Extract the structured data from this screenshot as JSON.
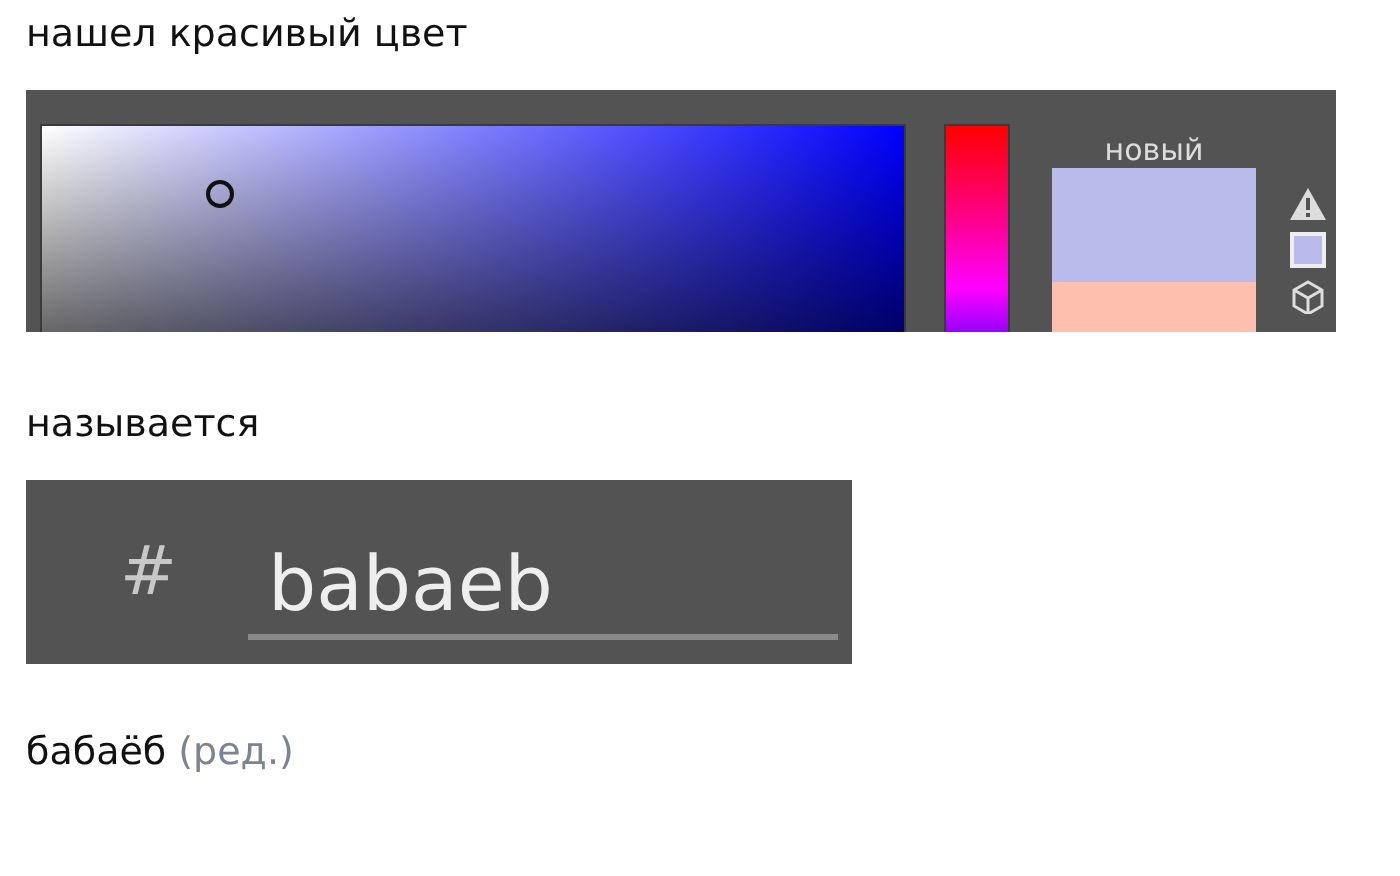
{
  "post_lines": [
    {
      "text": "нашел красивый цвет"
    }
  ],
  "color_picker": {
    "new_label": "новый",
    "swatches": [
      {
        "color": "#babaeb"
      },
      {
        "color": "#ffbfae"
      }
    ]
  },
  "middle_line": {
    "text": "называется"
  },
  "hex_field": {
    "prefix": "#",
    "value": "babaeb"
  },
  "caption": {
    "text": "бабаёб",
    "edited": "(ред.)"
  }
}
